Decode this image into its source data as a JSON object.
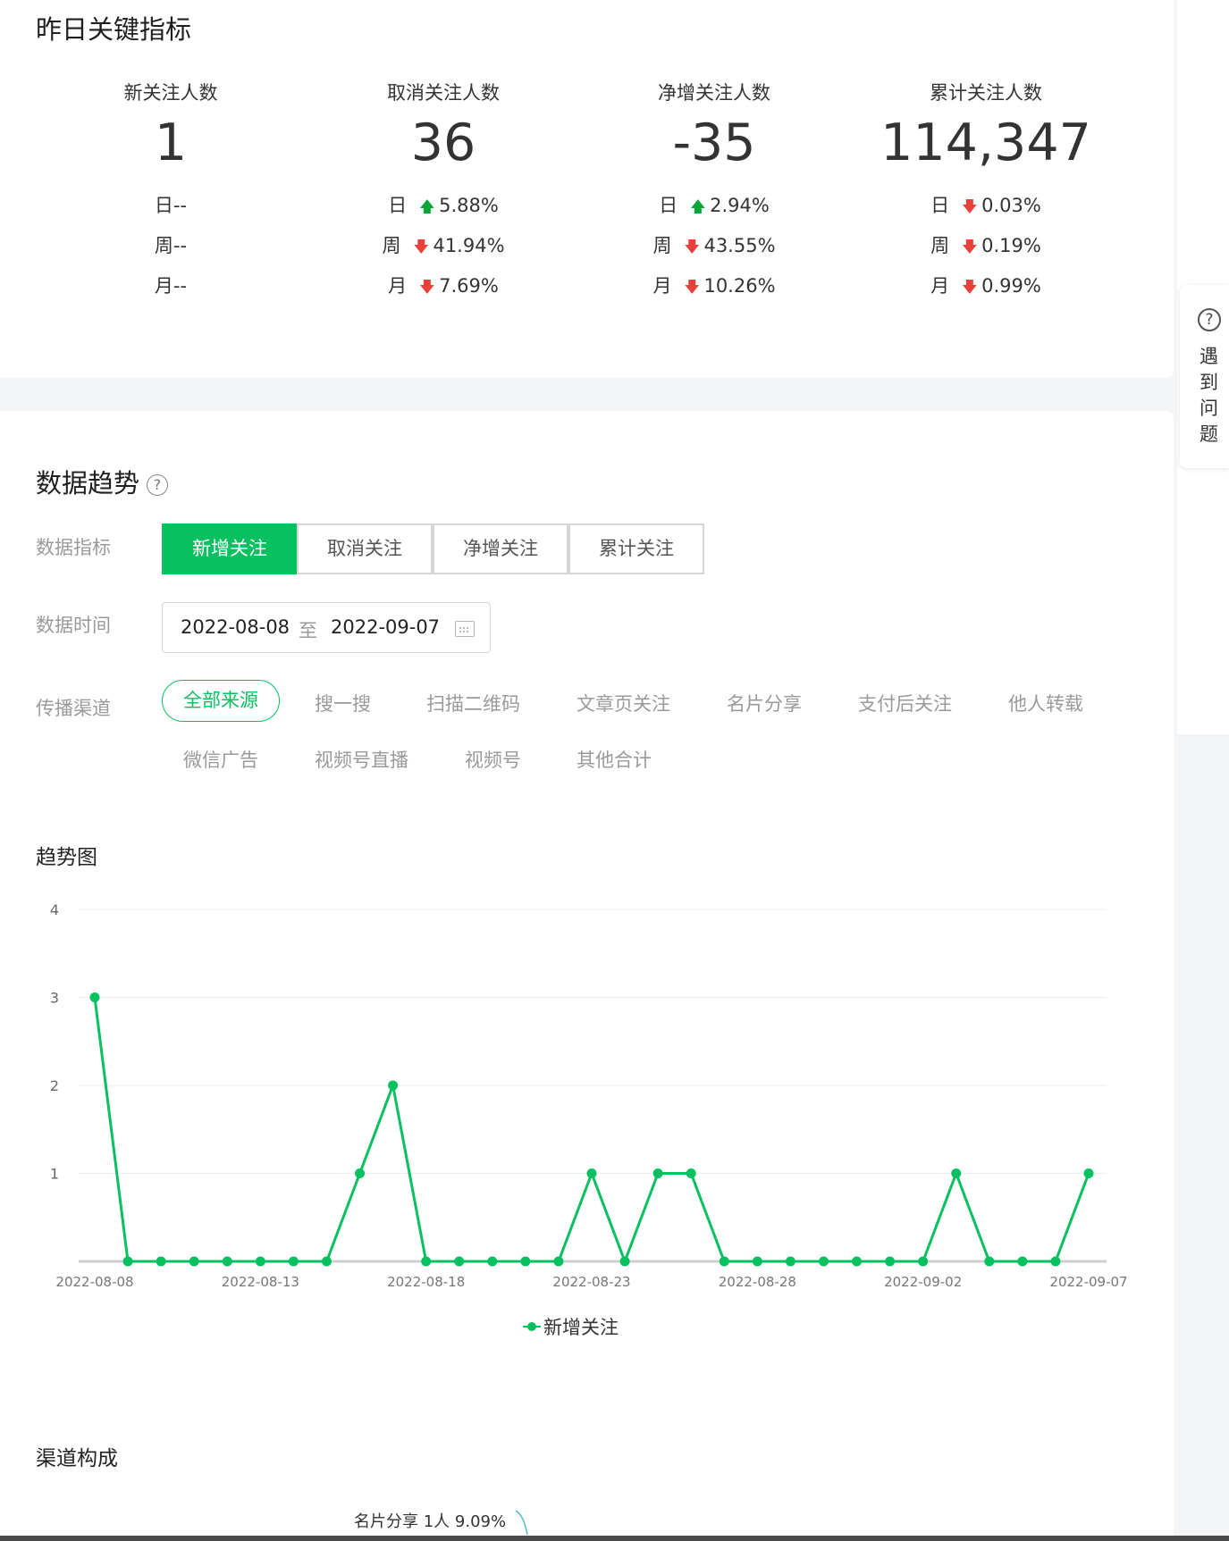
{
  "key_metrics": {
    "title": "昨日关键指标",
    "items": [
      {
        "label": "新关注人数",
        "value": "1",
        "rows": [
          {
            "period": "日",
            "arrow": "",
            "change": "--"
          },
          {
            "period": "周",
            "arrow": "",
            "change": "--"
          },
          {
            "period": "月",
            "arrow": "",
            "change": "--"
          }
        ]
      },
      {
        "label": "取消关注人数",
        "value": "36",
        "rows": [
          {
            "period": "日",
            "arrow": "up",
            "change": "5.88%"
          },
          {
            "period": "周",
            "arrow": "down",
            "change": "41.94%"
          },
          {
            "period": "月",
            "arrow": "down",
            "change": "7.69%"
          }
        ]
      },
      {
        "label": "净增关注人数",
        "value": "-35",
        "rows": [
          {
            "period": "日",
            "arrow": "up",
            "change": "2.94%"
          },
          {
            "period": "周",
            "arrow": "down",
            "change": "43.55%"
          },
          {
            "period": "月",
            "arrow": "down",
            "change": "10.26%"
          }
        ]
      },
      {
        "label": "累计关注人数",
        "value": "114,347",
        "rows": [
          {
            "period": "日",
            "arrow": "down",
            "change": "0.03%"
          },
          {
            "period": "周",
            "arrow": "down",
            "change": "0.19%"
          },
          {
            "period": "月",
            "arrow": "down",
            "change": "0.99%"
          }
        ]
      }
    ]
  },
  "help_panel": {
    "label": "遇到问题",
    "icon": "question-circle-icon"
  },
  "trend": {
    "title": "数据趋势",
    "metric_label": "数据指标",
    "metric_tabs": [
      "新增关注",
      "取消关注",
      "净增关注",
      "累计关注"
    ],
    "active_metric": 0,
    "time_label": "数据时间",
    "date_start": "2022-08-08",
    "date_sep": "至",
    "date_end": "2022-09-07",
    "channel_label": "传播渠道",
    "channels": [
      "全部来源",
      "搜一搜",
      "扫描二维码",
      "文章页关注",
      "名片分享",
      "支付后关注",
      "他人转载",
      "微信广告",
      "视频号直播",
      "视频号",
      "其他合计"
    ],
    "active_channel": 0,
    "chart_title": "趋势图",
    "legend": "新增关注"
  },
  "channel_section": {
    "title": "渠道构成",
    "pie_label": "名片分享 1人 9.09%"
  },
  "colors": {
    "accent": "#07c160",
    "up": "#09a53a",
    "down": "#e8413c"
  },
  "chart_data": {
    "type": "line",
    "x": [
      "2022-08-08",
      "2022-08-09",
      "2022-08-10",
      "2022-08-11",
      "2022-08-12",
      "2022-08-13",
      "2022-08-14",
      "2022-08-15",
      "2022-08-16",
      "2022-08-17",
      "2022-08-18",
      "2022-08-19",
      "2022-08-20",
      "2022-08-21",
      "2022-08-22",
      "2022-08-23",
      "2022-08-24",
      "2022-08-25",
      "2022-08-26",
      "2022-08-27",
      "2022-08-28",
      "2022-08-29",
      "2022-08-30",
      "2022-08-31",
      "2022-09-01",
      "2022-09-02",
      "2022-09-03",
      "2022-09-04",
      "2022-09-05",
      "2022-09-06",
      "2022-09-07"
    ],
    "x_tick_labels": [
      "2022-08-08",
      "2022-08-13",
      "2022-08-18",
      "2022-08-23",
      "2022-08-28",
      "2022-09-02",
      "2022-09-07"
    ],
    "series": [
      {
        "name": "新增关注",
        "values": [
          3,
          0,
          0,
          0,
          0,
          0,
          0,
          0,
          1,
          2,
          0,
          0,
          0,
          0,
          0,
          1,
          0,
          1,
          1,
          0,
          0,
          0,
          0,
          0,
          0,
          0,
          1,
          0,
          0,
          0,
          1
        ]
      }
    ],
    "yticks": [
      1,
      2,
      3,
      4
    ],
    "ylim": [
      0,
      4
    ],
    "grid": true,
    "legend_position": "bottom-center",
    "color": "#07c160"
  }
}
